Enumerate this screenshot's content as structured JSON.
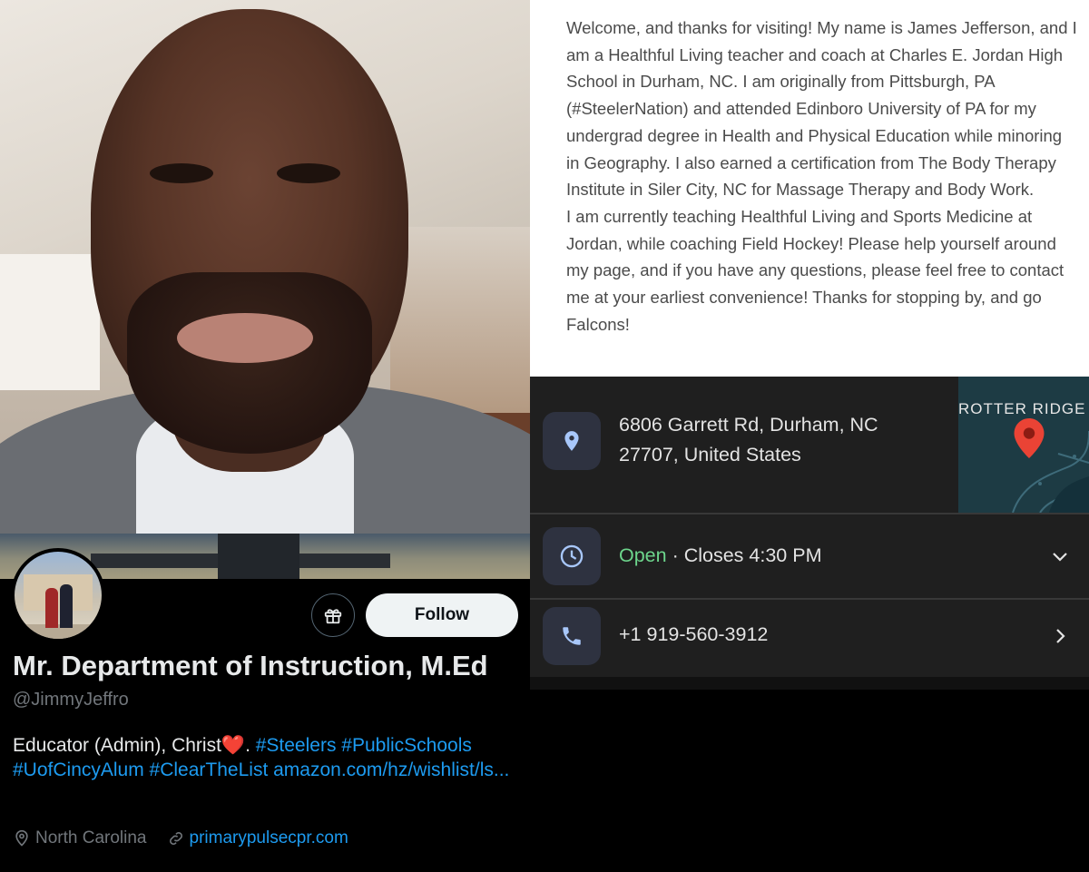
{
  "about": {
    "text": "Welcome, and thanks for visiting!  My name is James Jefferson, and I am a Healthful Living teacher and coach at Charles E. Jordan High School in Durham, NC.  I am originally from Pittsburgh, PA (#SteelerNation) and attended Edinboro University of PA for my undergrad degree in Health and Physical Education while minoring in Geography.  I also earned a certification from The Body Therapy Institute in Siler City, NC for Massage Therapy and Body Work.",
    "text2": "I am currently teaching Healthful Living and Sports Medicine at Jordan, while coaching Field Hockey!  Please help yourself around my page, and if you have any questions, please feel free to contact me at your earliest convenience!  Thanks for stopping by, and go Falcons!"
  },
  "profile": {
    "display_name": "Mr. Department of Instruction, M.Ed",
    "handle": "@JimmyJeffro",
    "bio_text": "Educator (Admin), Christ",
    "bio_heart": "❤️",
    "bio_after_heart": ". ",
    "bio_tags": "#Steelers #PublicSchools #UofCincyAlum #ClearTheList",
    "bio_link": "amazon.com/hz/wishlist/ls...",
    "location": "North Carolina",
    "website": "primarypulsecpr.com",
    "follow_label": "Follow",
    "gift_icon": "gift-icon"
  },
  "maps": {
    "address_line1": "6806 Garrett Rd, Durham, NC",
    "address_line2": "27707, United States",
    "map_label": "ROTTER RIDGE",
    "hours_status": "Open",
    "hours_sep": " · ",
    "hours_closes": "Closes 4:30 PM",
    "phone": "+1 919-560-3912",
    "colors": {
      "open": "#6dd58c",
      "pin": "#ea4335",
      "icon_bg": "#2e3240",
      "icon": "#a8c7fa"
    }
  }
}
